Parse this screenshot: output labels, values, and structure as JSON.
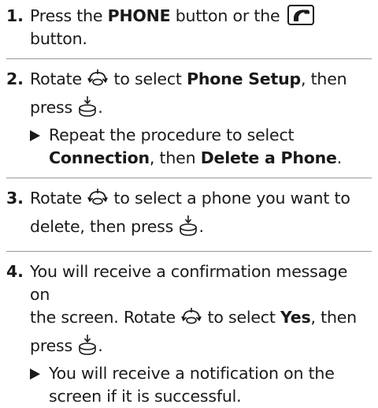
{
  "steps": [
    {
      "number": "1.",
      "t1": "Press the ",
      "b1": "PHONE",
      "t2": " button or the ",
      "t3": " button."
    },
    {
      "number": "2.",
      "t1": "Rotate ",
      "t2": " to select ",
      "b1": "Phone Setup",
      "t3": ", then",
      "t4": "press ",
      "t5": ".",
      "sub": {
        "t1": "Repeat the procedure to select",
        "b1": "Connection",
        "t2": ", then ",
        "b2": "Delete a Phone",
        "t3": "."
      }
    },
    {
      "number": "3.",
      "t1": "Rotate ",
      "t2": " to select a phone you want to",
      "t3": "delete, then press ",
      "t4": "."
    },
    {
      "number": "4.",
      "t1": "You will receive a confirmation message on",
      "t2": "the screen. Rotate ",
      "t3": " to select ",
      "b1": "Yes",
      "t4": ", then",
      "t5": "press ",
      "t6": ".",
      "sub": {
        "t1": "You will receive a notification on the",
        "t2": "screen if it is successful."
      }
    }
  ]
}
